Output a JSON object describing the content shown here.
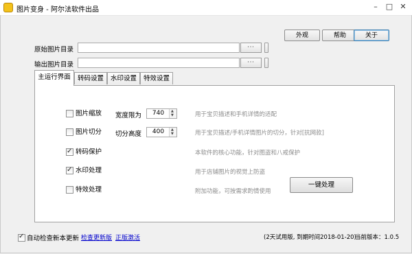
{
  "window": {
    "title": "图片变身 - 阿尔法软件出品",
    "minimize_icon": "minimize-icon",
    "maximize_icon": "maximize-icon",
    "close_icon": "close-icon"
  },
  "toolbar": {
    "appearance": "外观",
    "help": "帮助",
    "about": "关于"
  },
  "paths": {
    "source_label": "原始图片目录",
    "source_value": "",
    "output_label": "输出图片目录",
    "output_value": "",
    "browse_label": "···"
  },
  "tabs": [
    {
      "label": "主运行界面",
      "active": true
    },
    {
      "label": "转码设置",
      "active": false
    },
    {
      "label": "水印设置",
      "active": false
    },
    {
      "label": "特效设置",
      "active": false
    }
  ],
  "options": [
    {
      "label": "图片缩放",
      "checked": false,
      "desc": "用于宝贝描述和手机详情的适配"
    },
    {
      "label": "图片切分",
      "checked": false,
      "desc": "用于宝贝描述/手机详情图片的切分，针对[抗网款]"
    },
    {
      "label": "转码保护",
      "checked": true,
      "desc": "本软件的核心功能，针对图盗和八戒保护"
    },
    {
      "label": "水印处理",
      "checked": true,
      "desc": "用于店铺图片的视觉上防盗"
    },
    {
      "label": "特效处理",
      "checked": false,
      "desc": "附加功能，可按需求酌情使用"
    }
  ],
  "width_limit": {
    "label": "宽度限为",
    "value": "740"
  },
  "split_height": {
    "label": "切分高度",
    "value": "400"
  },
  "run_button": "一键处理",
  "footer": {
    "auto_update_label": "自动检查新本更新",
    "auto_update_checked": true,
    "check_update_link": "检查更新版",
    "activate_link": "正版激活",
    "trial_info": "(2天试用版, 到期时间2018-01-20)",
    "version": "当前版本：1.0.5"
  }
}
